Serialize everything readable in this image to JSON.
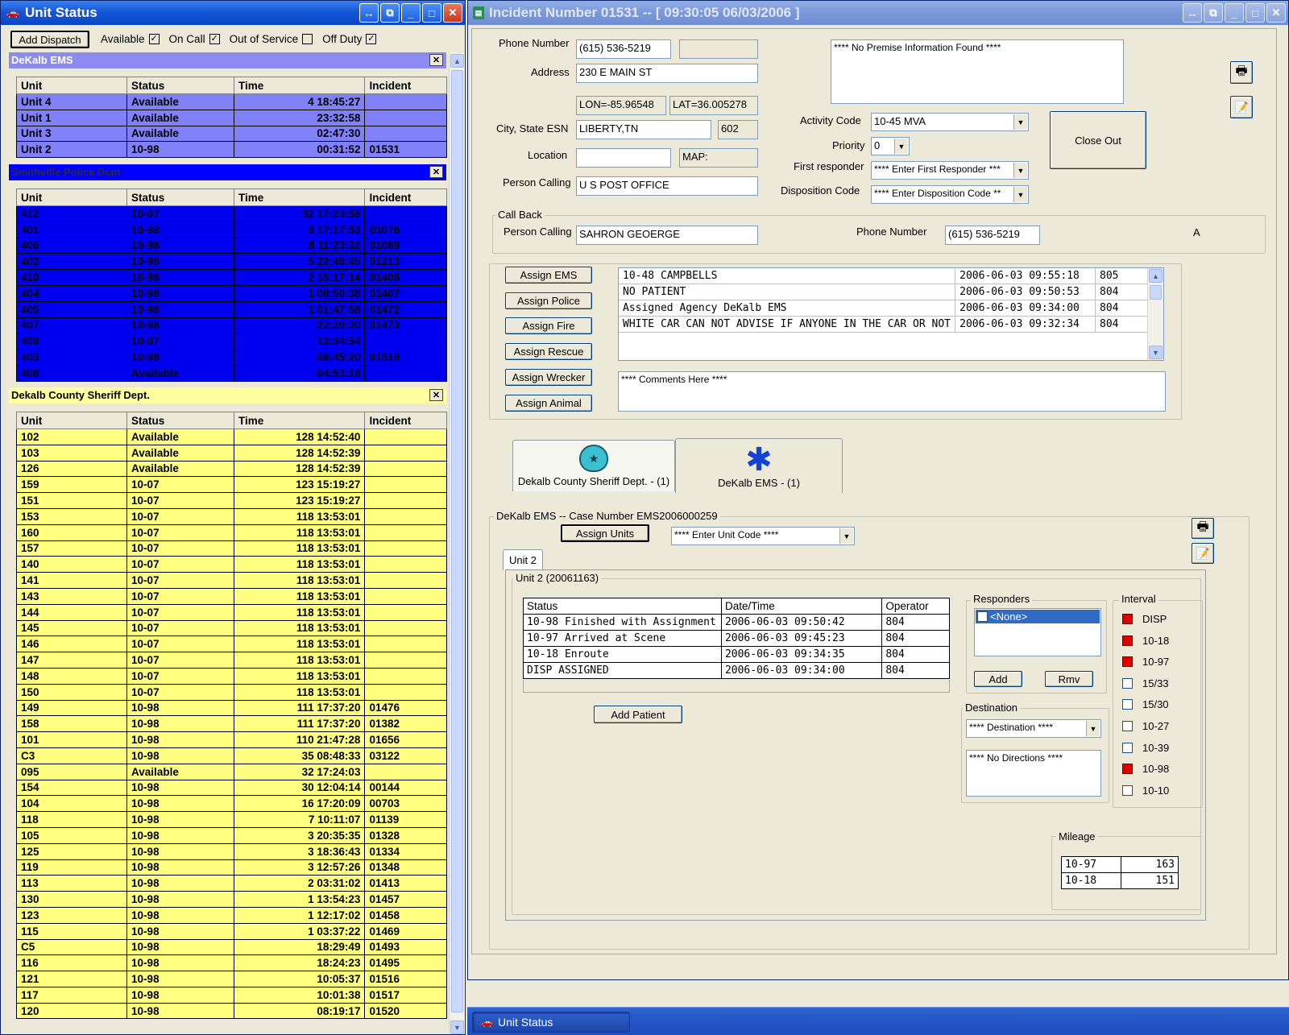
{
  "unit_status": {
    "title": "Unit Status",
    "add_dispatch": "Add Dispatch",
    "filters": [
      {
        "label": "Available",
        "checked": true
      },
      {
        "label": "On Call",
        "checked": true
      },
      {
        "label": "Out of Service",
        "checked": false
      },
      {
        "label": "Off Duty",
        "checked": true
      }
    ],
    "columns": [
      "Unit",
      "Status",
      "Time",
      "Incident"
    ],
    "sections": [
      {
        "name": "DeKalb EMS",
        "header_color": "#8c8cf0",
        "row_color": "#8080f8",
        "text_color": "#000000",
        "rows": [
          [
            "Unit 4",
            "Available",
            "4 18:45:27",
            ""
          ],
          [
            "Unit 1",
            "Available",
            "23:32:58",
            ""
          ],
          [
            "Unit 3",
            "Available",
            "02:47:30",
            ""
          ],
          [
            "Unit 2",
            "10-98",
            "00:31:52",
            "01531"
          ]
        ]
      },
      {
        "name": "Smithville Police Dept",
        "header_color": "#0000ff",
        "row_color": "#0000f0",
        "text_color": "#000000",
        "rows": [
          [
            "412",
            "10-07",
            "32 17:23:56",
            ""
          ],
          [
            "401",
            "10-98",
            "8 17:17:53",
            "01076"
          ],
          [
            "406",
            "10-98",
            "8 11:23:32",
            "01089"
          ],
          [
            "402",
            "10-98",
            "5 22:46:45",
            "01213"
          ],
          [
            "410",
            "10-98",
            "2 15:17:14",
            "01408"
          ],
          [
            "404",
            "10-98",
            "1 08:50:38",
            "01467"
          ],
          [
            "405",
            "10-98",
            "1 01:47:58",
            "01472"
          ],
          [
            "407",
            "10-98",
            "22:20:30",
            "01473"
          ],
          [
            "409",
            "10-07",
            "13:34:54",
            ""
          ],
          [
            "403",
            "10-98",
            "08:45:20",
            "01519"
          ],
          [
            "408",
            "Available",
            "04:53:18",
            ""
          ]
        ]
      },
      {
        "name": "Dekalb County Sheriff Dept.",
        "header_color": "#ffffa0",
        "row_color": "#ffff80",
        "text_color": "#000000",
        "rows": [
          [
            "102",
            "Available",
            "128 14:52:40",
            ""
          ],
          [
            "103",
            "Available",
            "128 14:52:39",
            ""
          ],
          [
            "126",
            "Available",
            "128 14:52:39",
            ""
          ],
          [
            "159",
            "10-07",
            "123 15:19:27",
            ""
          ],
          [
            "151",
            "10-07",
            "123 15:19:27",
            ""
          ],
          [
            "153",
            "10-07",
            "118 13:53:01",
            ""
          ],
          [
            "160",
            "10-07",
            "118 13:53:01",
            ""
          ],
          [
            "157",
            "10-07",
            "118 13:53:01",
            ""
          ],
          [
            "140",
            "10-07",
            "118 13:53:01",
            ""
          ],
          [
            "141",
            "10-07",
            "118 13:53:01",
            ""
          ],
          [
            "143",
            "10-07",
            "118 13:53:01",
            ""
          ],
          [
            "144",
            "10-07",
            "118 13:53:01",
            ""
          ],
          [
            "145",
            "10-07",
            "118 13:53:01",
            ""
          ],
          [
            "146",
            "10-07",
            "118 13:53:01",
            ""
          ],
          [
            "147",
            "10-07",
            "118 13:53:01",
            ""
          ],
          [
            "148",
            "10-07",
            "118 13:53:01",
            ""
          ],
          [
            "150",
            "10-07",
            "118 13:53:01",
            ""
          ],
          [
            "149",
            "10-98",
            "111 17:37:20",
            "01476"
          ],
          [
            "158",
            "10-98",
            "111 17:37:20",
            "01382"
          ],
          [
            "101",
            "10-98",
            "110 21:47:28",
            "01656"
          ],
          [
            "C3",
            "10-98",
            "35 08:48:33",
            "03122"
          ],
          [
            "095",
            "Available",
            "32 17:24:03",
            ""
          ],
          [
            "154",
            "10-98",
            "30 12:04:14",
            "00144"
          ],
          [
            "104",
            "10-98",
            "16 17:20:09",
            "00703"
          ],
          [
            "118",
            "10-98",
            "7 10:11:07",
            "01139"
          ],
          [
            "105",
            "10-98",
            "3 20:35:35",
            "01328"
          ],
          [
            "125",
            "10-98",
            "3 18:36:43",
            "01334"
          ],
          [
            "119",
            "10-98",
            "3 12:57:26",
            "01348"
          ],
          [
            "113",
            "10-98",
            "2 03:31:02",
            "01413"
          ],
          [
            "130",
            "10-98",
            "1 13:54:23",
            "01457"
          ],
          [
            "123",
            "10-98",
            "1 12:17:02",
            "01458"
          ],
          [
            "115",
            "10-98",
            "1 03:37:22",
            "01469"
          ],
          [
            "C5",
            "10-98",
            "18:29:49",
            "01493"
          ],
          [
            "116",
            "10-98",
            "18:24:23",
            "01495"
          ],
          [
            "121",
            "10-98",
            "10:05:37",
            "01516"
          ],
          [
            "117",
            "10-98",
            "10:01:38",
            "01517"
          ],
          [
            "120",
            "10-98",
            "08:19:17",
            "01520"
          ]
        ]
      }
    ]
  },
  "incident": {
    "title": "Incident Number 01531   -- [ 09:30:05     06/03/2006 ]",
    "phone_label": "Phone Number",
    "phone": "(615) 536-5219",
    "phone_ext": "",
    "address_label": "Address",
    "address": "230 E MAIN ST",
    "lon": "LON=-85.96548",
    "lat": "LAT=36.005278",
    "city_label": "City, State ESN",
    "city": "LIBERTY,TN",
    "esn": "602",
    "location_label": "Location",
    "location": "",
    "map": "MAP:",
    "person_calling_label": "Person Calling",
    "person_calling": "U S POST OFFICE",
    "premise": "**** No Premise Information Found ****",
    "activity_code_label": "Activity Code",
    "activity_code": "10-45 MVA",
    "priority_label": "Priority",
    "priority": "0",
    "first_responder_label": "First responder",
    "first_responder": "**** Enter First Responder ***",
    "disposition_label": "Disposition  Code",
    "disposition": "**** Enter Disposition Code **",
    "close_out": "Close Out",
    "callback": {
      "group": "Call Back",
      "person_label": "Person Calling",
      "person": "SAHRON GEOERGE",
      "phone_label": "Phone Number",
      "phone": "(615) 536-5219",
      "a": "A"
    },
    "assign_buttons": [
      "Assign EMS",
      "Assign Police",
      "Assign Fire",
      "Assign Rescue",
      "Assign Wrecker",
      "Assign Animal"
    ],
    "log": [
      [
        "10-48 CAMPBELLS",
        "2006-06-03 09:55:18",
        "805"
      ],
      [
        "NO PATIENT",
        "2006-06-03 09:50:53",
        "804"
      ],
      [
        "Assigned Agency DeKalb EMS",
        "2006-06-03 09:34:00",
        "804"
      ],
      [
        "WHITE CAR CAN NOT ADVISE IF ANYONE IN THE CAR OR NOT",
        "2006-06-03 09:32:34",
        "804"
      ]
    ],
    "comments": "**** Comments Here ****",
    "agency_tabs": [
      "Dekalb County Sheriff Dept. - (1)",
      "DeKalb EMS - (1)"
    ],
    "case": {
      "group": "DeKalb EMS -- Case Number EMS2006000259",
      "assign_units": "Assign Units",
      "unit_code": "**** Enter Unit Code ****",
      "unit_tab": "Unit 2",
      "unit_group": "Unit 2 (20061163)",
      "status_columns": [
        "Status",
        "Date/Time",
        "Operator"
      ],
      "status_rows": [
        [
          "10-98 Finished with Assignment",
          "2006-06-03 09:50:42",
          "804"
        ],
        [
          "10-97 Arrived at Scene",
          "2006-06-03 09:45:23",
          "804"
        ],
        [
          "10-18 Enroute",
          "2006-06-03 09:34:35",
          "804"
        ],
        [
          "DISP ASSIGNED",
          "2006-06-03 09:34:00",
          "804"
        ]
      ],
      "add_patient": "Add Patient",
      "responders_label": "Responders",
      "responder_item": "<None>",
      "add": "Add",
      "rmv": "Rmv",
      "destination_label": "Destination",
      "destination": "**** Destination ****",
      "directions": "**** No Directions ****",
      "interval_label": "Interval",
      "intervals": [
        {
          "label": "DISP",
          "on": true
        },
        {
          "label": "10-18",
          "on": true
        },
        {
          "label": "10-97",
          "on": true
        },
        {
          "label": "15/33",
          "on": false
        },
        {
          "label": "15/30",
          "on": false
        },
        {
          "label": "10-27",
          "on": false
        },
        {
          "label": "10-39",
          "on": false
        },
        {
          "label": "10-98",
          "on": true
        },
        {
          "label": "10-10",
          "on": false
        }
      ],
      "mileage_label": "Mileage",
      "mileage": [
        [
          "10-97",
          "163"
        ],
        [
          "10-18",
          "151"
        ]
      ]
    }
  },
  "taskbar": {
    "item": "Unit Status"
  }
}
